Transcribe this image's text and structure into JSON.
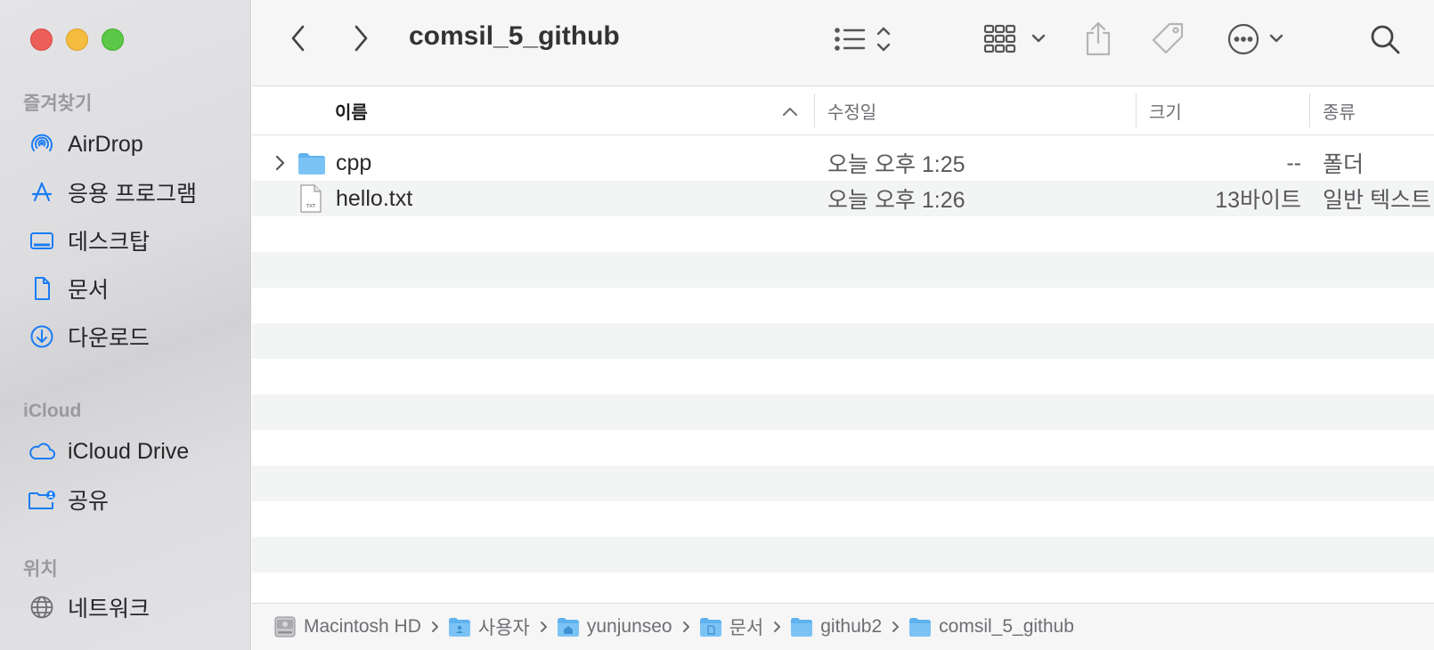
{
  "window": {
    "title": "comsil_5_github"
  },
  "sidebar": {
    "favorites_label": "즐겨찾기",
    "favorites": [
      {
        "label": "AirDrop",
        "icon": "airdrop-icon"
      },
      {
        "label": "응용 프로그램",
        "icon": "applications-icon"
      },
      {
        "label": "데스크탑",
        "icon": "desktop-icon"
      },
      {
        "label": "문서",
        "icon": "document-icon"
      },
      {
        "label": "다운로드",
        "icon": "download-icon"
      }
    ],
    "icloud_label": "iCloud",
    "icloud": [
      {
        "label": "iCloud Drive",
        "icon": "cloud-icon"
      },
      {
        "label": "공유",
        "icon": "shared-folder-icon"
      }
    ],
    "locations_label": "위치",
    "locations": [
      {
        "label": "네트워크",
        "icon": "globe-icon"
      }
    ]
  },
  "columns": {
    "name": "이름",
    "modified": "수정일",
    "size": "크기",
    "kind": "종류"
  },
  "files": [
    {
      "name": "cpp",
      "modified": "오늘 오후 1:25",
      "size": "--",
      "kind": "폴더",
      "type": "folder"
    },
    {
      "name": "hello.txt",
      "modified": "오늘 오후 1:26",
      "size": "13바이트",
      "kind": "일반 텍스트",
      "type": "txt",
      "badge": "TXT"
    }
  ],
  "pathbar": [
    {
      "label": "Macintosh HD",
      "icon": "hard-drive-icon"
    },
    {
      "label": "사용자",
      "icon": "users-folder-icon"
    },
    {
      "label": "yunjunseo",
      "icon": "home-folder-icon"
    },
    {
      "label": "문서",
      "icon": "documents-folder-icon"
    },
    {
      "label": "github2",
      "icon": "folder-icon"
    },
    {
      "label": "comsil_5_github",
      "icon": "folder-icon"
    }
  ],
  "colors": {
    "accent": "#1a7cf5",
    "folder": "#5fb2f0",
    "sidebar_bg": "#dedee0"
  }
}
